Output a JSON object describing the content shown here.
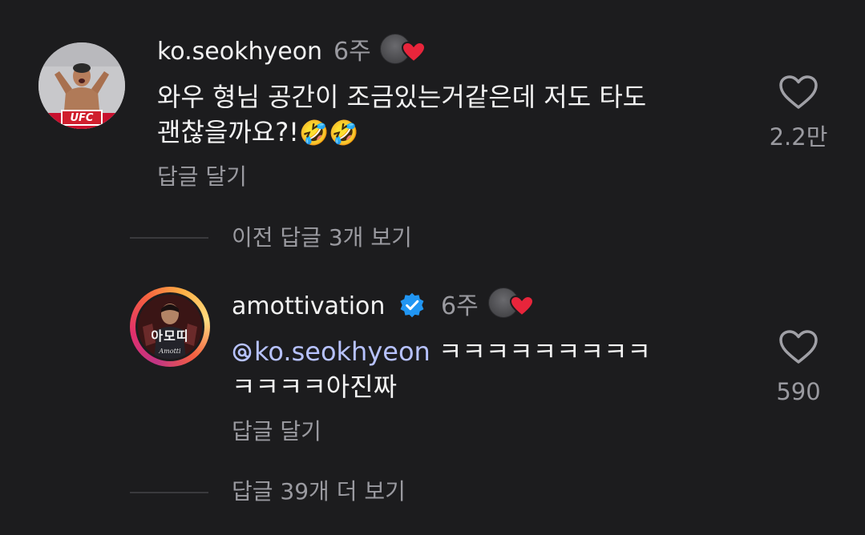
{
  "comment1": {
    "username": "ko.seokhyeon",
    "time": "6주",
    "text_line1": "와우 형님 공간이 조금있는거같은데 저도 타도",
    "text_line2": "괜찮을까요?!",
    "emoji": "🤣🤣",
    "reply_label": "답글 달기",
    "likes": "2.2만",
    "avatar_badge": "UFC"
  },
  "view_previous_replies": "이전 답글 3개 보기",
  "comment2": {
    "username": "amottivation",
    "time": "6주",
    "mention": "ko.seokhyeon",
    "text_line1_rest": " ㅋㅋㅋㅋㅋㅋㅋㅋㅋ",
    "text_line2": "ㅋㅋㅋㅋ아진짜",
    "reply_label": "답글 달기",
    "likes": "590",
    "avatar_text": "아모띠",
    "avatar_sub": "Amotti"
  },
  "view_more_replies": "답글 39개 더 보기",
  "colors": {
    "background": "#1c1c1e",
    "text": "#f2f2f2",
    "muted": "#9a9aa0",
    "verified": "#2196f3",
    "heart": "#e8253b"
  }
}
